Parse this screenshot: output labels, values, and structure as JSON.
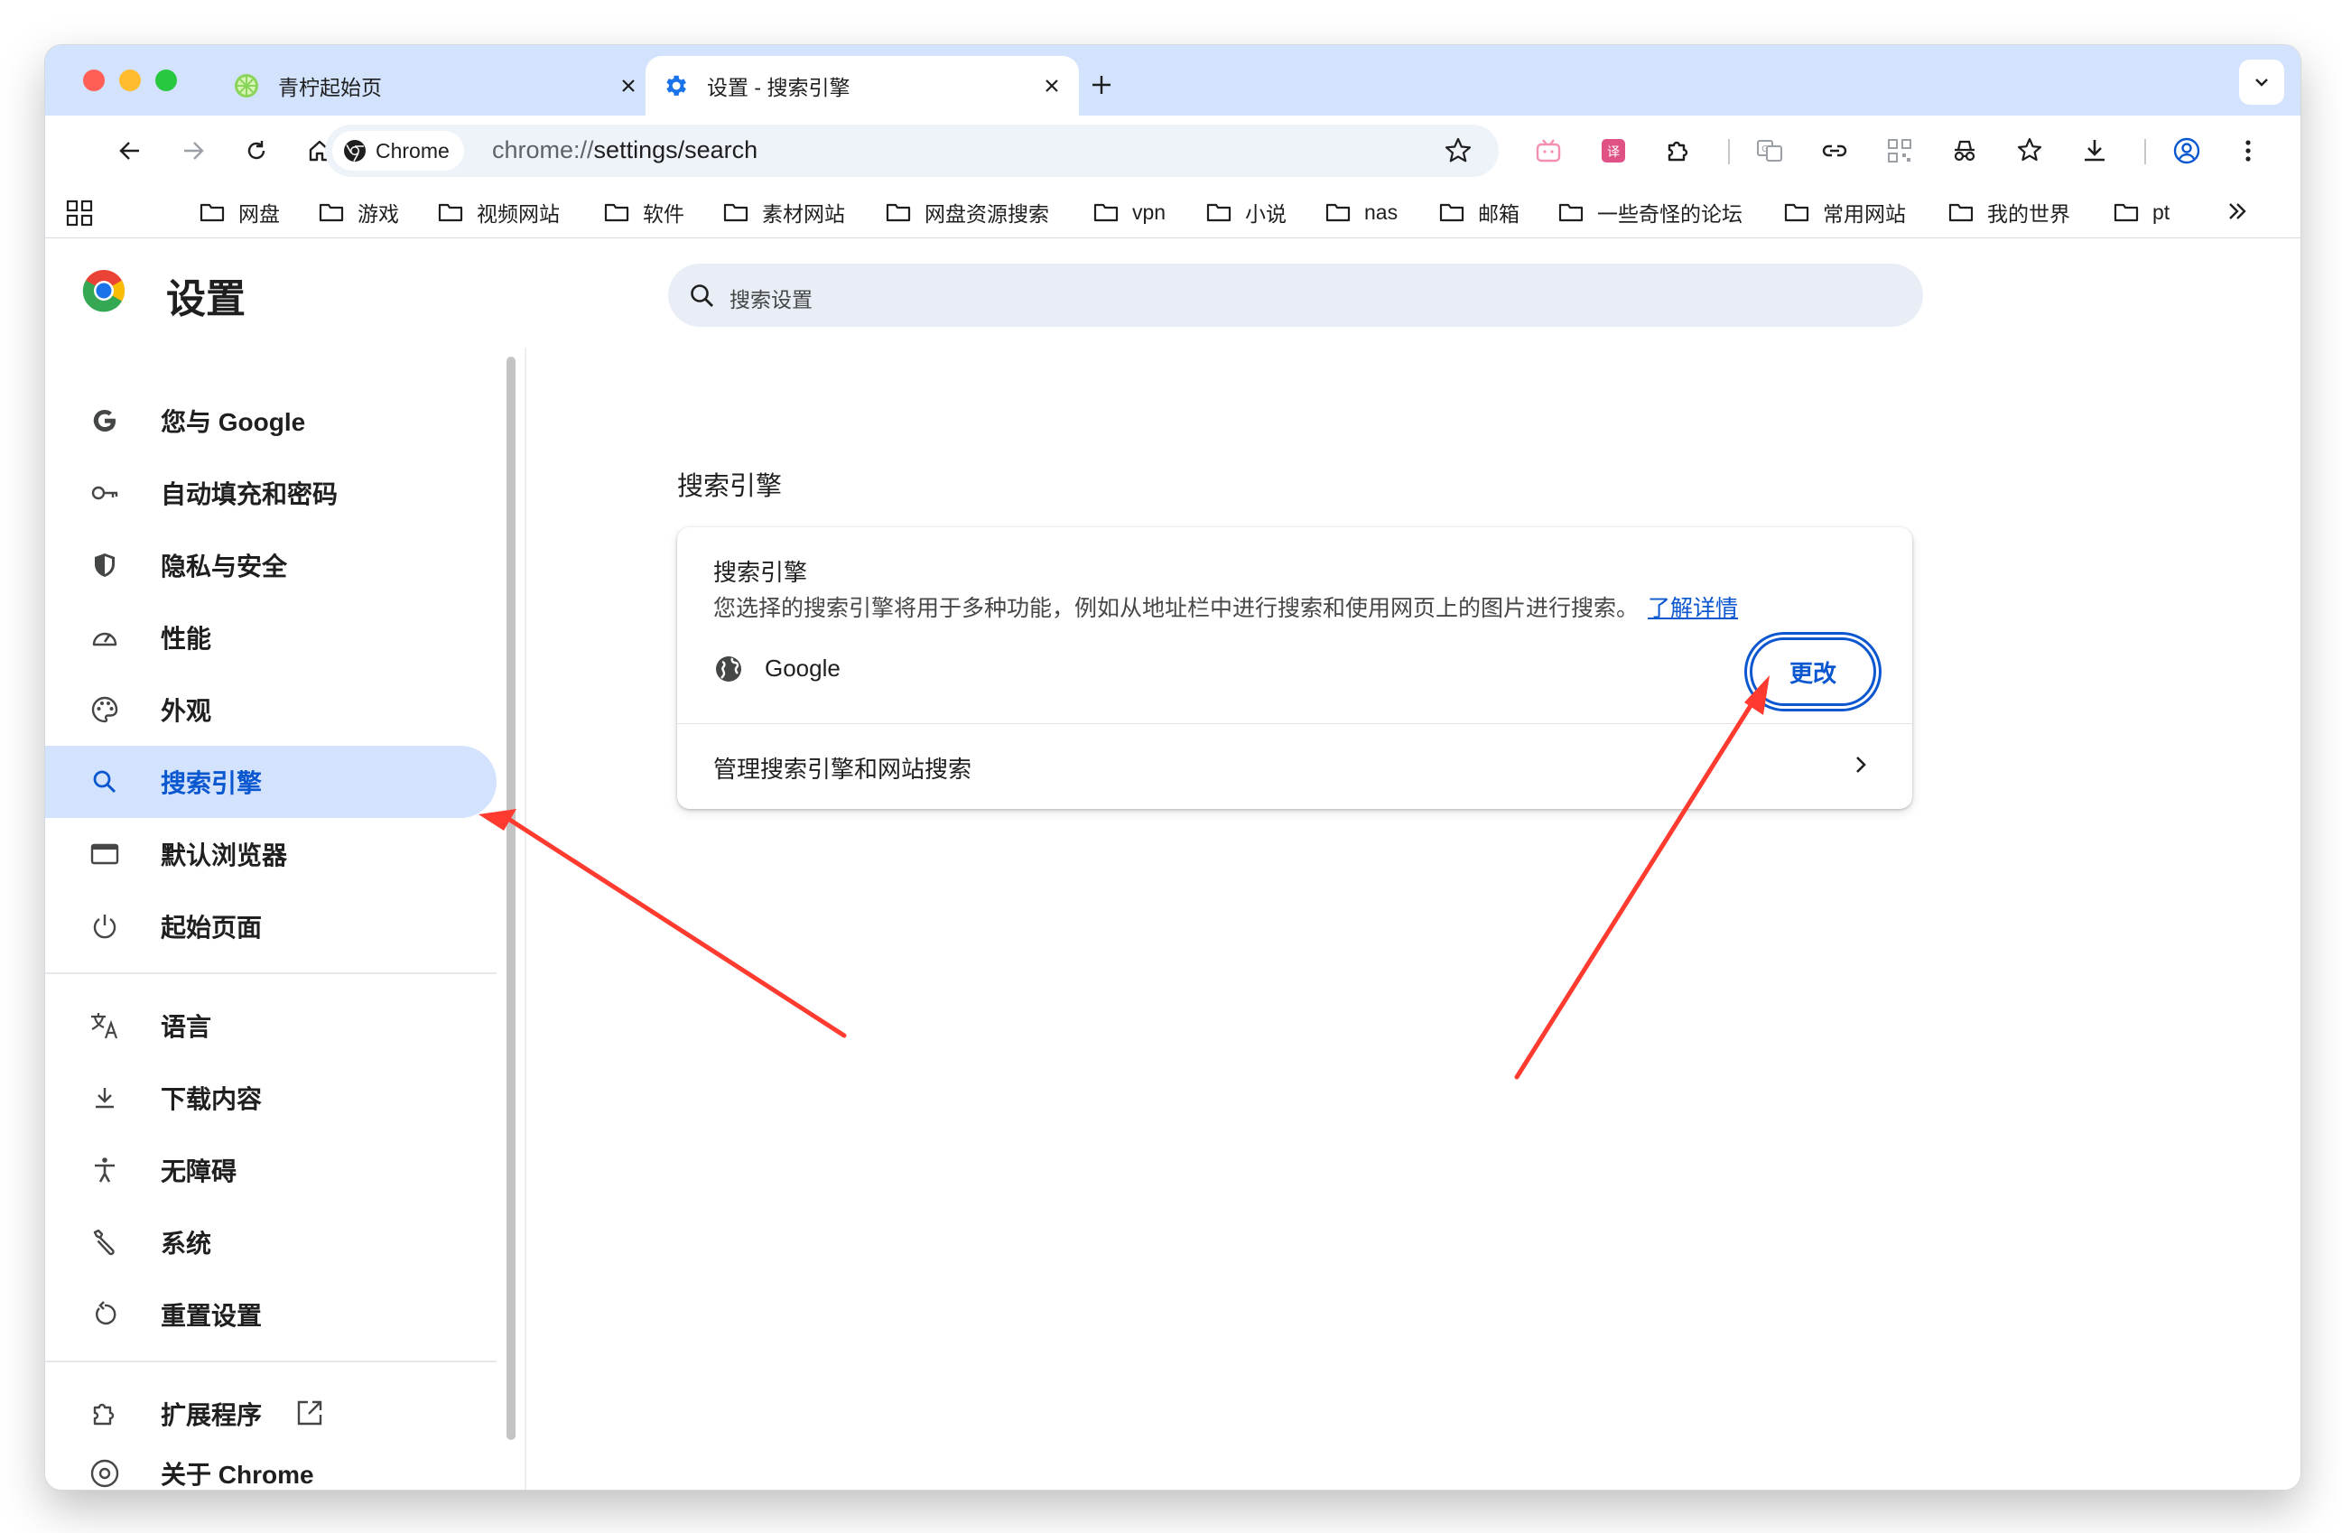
{
  "tabs": [
    {
      "title": "青柠起始页"
    },
    {
      "title": "设置 - 搜索引擎"
    }
  ],
  "toolbar": {
    "chip_label": "Chrome",
    "url_host": "chrome://",
    "url_path": "settings/search"
  },
  "bookmarks": [
    "网盘",
    "游戏",
    "视频网站",
    "软件",
    "素材网站",
    "网盘资源搜索",
    "vpn",
    "小说",
    "nas",
    "邮箱",
    "一些奇怪的论坛",
    "常用网站",
    "我的世界",
    "pt"
  ],
  "settings": {
    "title": "设置",
    "search_placeholder": "搜索设置"
  },
  "sidebar": {
    "items": [
      {
        "label": "您与 Google"
      },
      {
        "label": "自动填充和密码"
      },
      {
        "label": "隐私与安全"
      },
      {
        "label": "性能"
      },
      {
        "label": "外观"
      },
      {
        "label": "搜索引擎"
      },
      {
        "label": "默认浏览器"
      },
      {
        "label": "起始页面"
      },
      {
        "label": "语言"
      },
      {
        "label": "下载内容"
      },
      {
        "label": "无障碍"
      },
      {
        "label": "系统"
      },
      {
        "label": "重置设置"
      },
      {
        "label": "扩展程序"
      },
      {
        "label": "关于 Chrome"
      }
    ]
  },
  "main": {
    "section_title": "搜索引擎",
    "card_heading": "搜索引擎",
    "card_description": "您选择的搜索引擎将用于多种功能，例如从地址栏中进行搜索和使用网页上的图片进行搜索。",
    "learn_more": "了解详情",
    "engine_name": "Google",
    "change_button": "更改",
    "manage_row": "管理搜索引擎和网站搜索"
  },
  "colors": {
    "accent": "#0b57d0",
    "tabstrip": "#d3e3fd",
    "annotation_arrow": "#ff3b30"
  }
}
